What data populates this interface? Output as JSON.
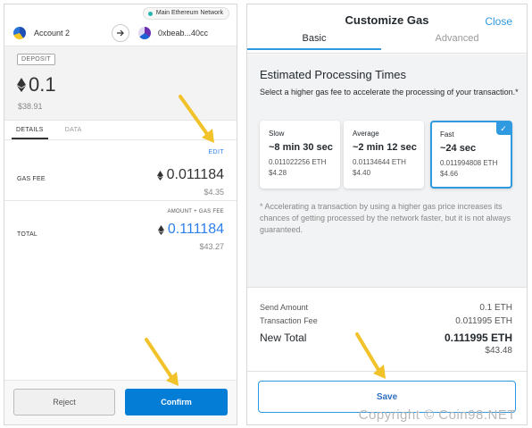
{
  "left_panel": {
    "network": "Main Ethereum Network",
    "from_account": "Account 2",
    "to_account": "0xbeab...40cc",
    "badge": "DEPOSIT",
    "amount_eth": "0.1",
    "amount_usd": "$38.91",
    "tabs": [
      {
        "label": "DETAILS",
        "active": true
      },
      {
        "label": "DATA",
        "active": false
      }
    ],
    "edit_label": "EDIT",
    "gas_fee": {
      "label": "GAS FEE",
      "eth": "0.011184",
      "usd": "$4.35"
    },
    "amount_gas_label": "AMOUNT + GAS FEE",
    "total": {
      "label": "TOTAL",
      "eth": "0.111184",
      "usd": "$43.27"
    },
    "reject_label": "Reject",
    "confirm_label": "Confirm"
  },
  "right_panel": {
    "title": "Customize Gas",
    "close_label": "Close",
    "tabs": [
      {
        "label": "Basic",
        "active": true
      },
      {
        "label": "Advanced",
        "active": false
      }
    ],
    "heading": "Estimated Processing Times",
    "subheading": "Select a higher gas fee to accelerate the processing of your transaction.*",
    "options": [
      {
        "label": "Slow",
        "time": "~8 min 30 sec",
        "eth": "0.011022256 ETH",
        "usd": "$4.28",
        "selected": false
      },
      {
        "label": "Average",
        "time": "~2 min 12 sec",
        "eth": "0.01134644 ETH",
        "usd": "$4.40",
        "selected": false
      },
      {
        "label": "Fast",
        "time": "~24 sec",
        "eth": "0.011994808 ETH",
        "usd": "$4.66",
        "selected": true
      }
    ],
    "disclaimer": "* Accelerating a transaction by using a higher gas price increases its chances of getting processed by the network faster, but it is not always guaranteed.",
    "send_amount": {
      "label": "Send Amount",
      "value": "0.1 ETH"
    },
    "transaction_fee": {
      "label": "Transaction Fee",
      "value": "0.011995 ETH"
    },
    "new_total": {
      "label": "New Total",
      "value": "0.111995 ETH",
      "usd": "$43.48"
    },
    "save_label": "Save"
  },
  "watermark": "Copyright © Coin98.NET",
  "colors": {
    "confirm_blue": "#037dd6",
    "accent_blue": "#2f9ae0",
    "link_blue": "#2f80ed",
    "annotation_arrow": "#f2c22b",
    "network_dot": "#29b6af"
  },
  "icons": [
    "ethereum-icon",
    "arrow-right-icon",
    "checkmark-icon",
    "annotation-arrow"
  ]
}
